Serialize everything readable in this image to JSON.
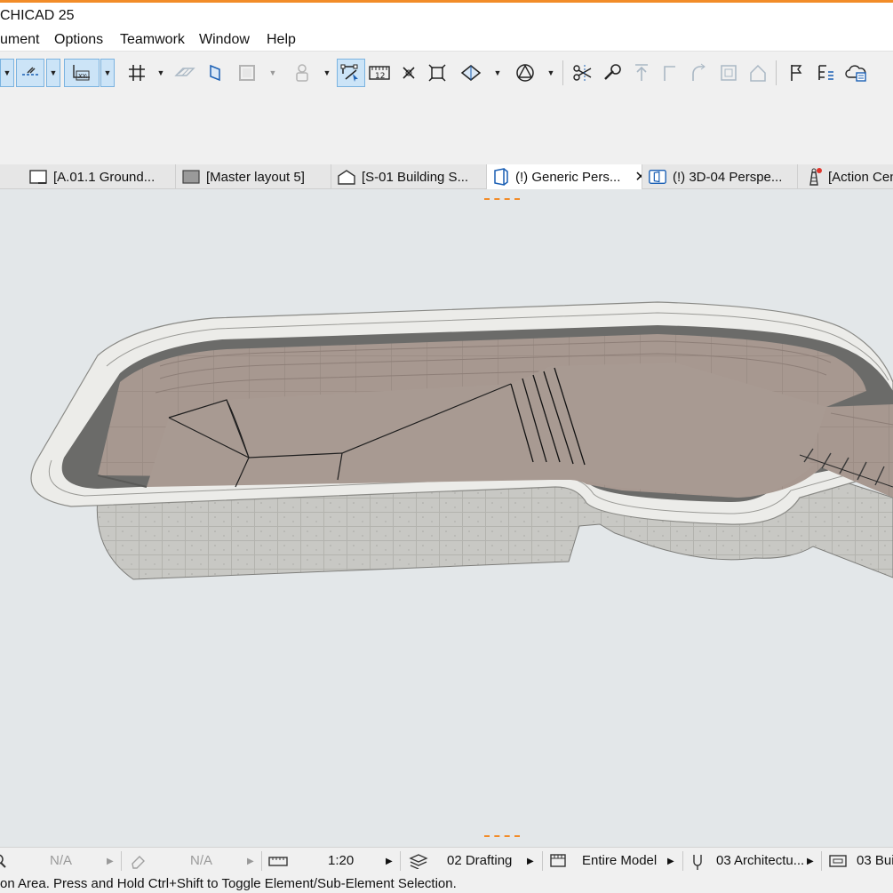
{
  "app": {
    "title": "CHICAD 25"
  },
  "menu": [
    "ument",
    "Options",
    "Teamwork",
    "Window",
    "Help"
  ],
  "toolbar": {
    "icons": [
      "snap-guides-icon",
      "guide-lines-icon",
      "xy-coordinates-icon",
      "grid-snap-icon",
      "surface-plane-icon",
      "edit-plane-icon",
      "outline-icon",
      "person-icon",
      "selection-mode-icon",
      "dimension-icon",
      "intersection-icon",
      "fit-window-icon",
      "3d-view-icon",
      "geometry-icon",
      "split-icon",
      "adjust-icon",
      "elevate-icon",
      "corner-icon",
      "rotate-icon",
      "offset-icon",
      "roof-icon",
      "flag-icon",
      "list-icon",
      "cloud-icon"
    ]
  },
  "tabs": [
    {
      "label": "[A.01.1 Ground...",
      "icon": "floor-plan-icon"
    },
    {
      "label": "[Master layout 5]",
      "icon": "master-layout-icon"
    },
    {
      "label": "[S-01 Building S...",
      "icon": "section-icon"
    },
    {
      "label": "(!) Generic Pers...",
      "icon": "perspective-icon",
      "active": true,
      "close": "✕"
    },
    {
      "label": "(!) 3D-04 Perspe...",
      "icon": "3d-document-icon"
    },
    {
      "label": "[Action Cen",
      "icon": "action-center-icon"
    }
  ],
  "status": {
    "na1": "N/A",
    "na2": "N/A",
    "scale": "1:20",
    "layer_combo": "02 Drafting",
    "model_view": "Entire Model",
    "pen_set": "03 Architectu...",
    "renovation": "03 Bui"
  },
  "hint": "on Area. Press and Hold Ctrl+Shift to Toggle Element/Sub-Element Selection.",
  "colors": {
    "accent": "#f28c28",
    "viewport_bg": "#e3e7e9",
    "coping": "#ececea",
    "wall_concrete": "#c6c6c2",
    "tile_beige": "#a9968e",
    "dark_band": "#6d6d6d",
    "selection": "#cce4f7"
  }
}
